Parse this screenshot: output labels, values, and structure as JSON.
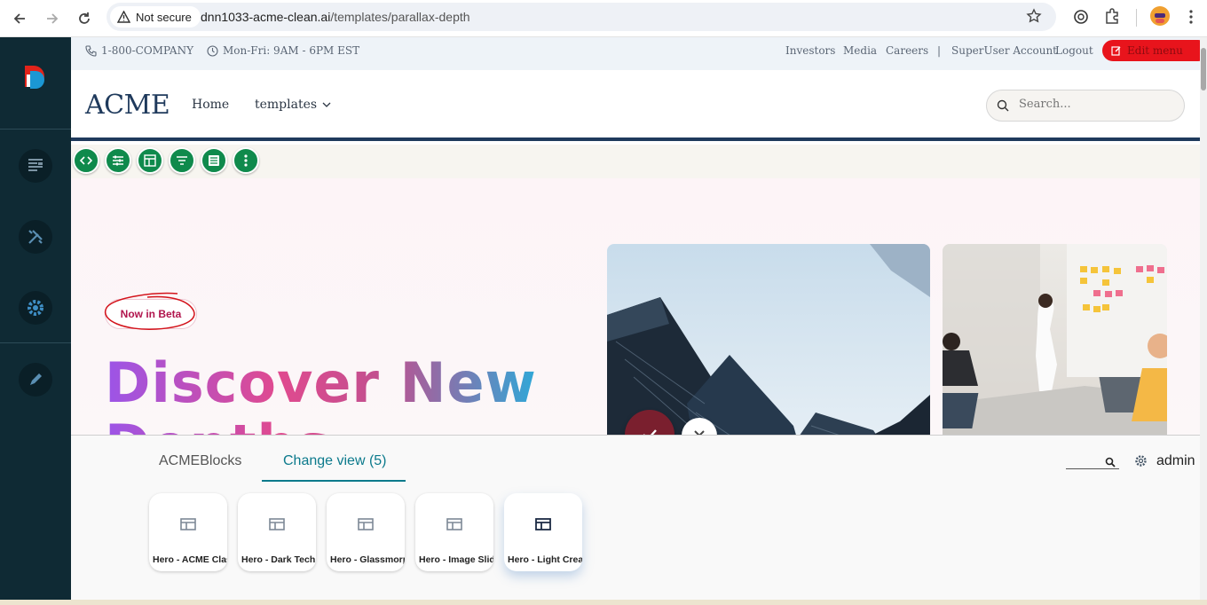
{
  "browser": {
    "security_label": "Not secure",
    "url_host": "dnn1033-acme-clean.ai",
    "url_path": "/templates/parallax-depth"
  },
  "topbar": {
    "phone": "1-800-COMPANY",
    "hours": "Mon-Fri: 9AM - 6PM EST",
    "links": [
      "Investors",
      "Media",
      "Careers"
    ],
    "separator": "|",
    "account": "SuperUser Account",
    "logout": "Logout",
    "edit_menu": "Edit menu"
  },
  "header": {
    "logo": "ACME",
    "nav": {
      "home": "Home",
      "templates": "templates"
    },
    "search_placeholder": "Search..."
  },
  "hero": {
    "badge": "Now in Beta",
    "title_line1": "Discover New",
    "title_line2": "Depths"
  },
  "panel": {
    "tab_blocks": "ACMEBlocks",
    "tab_change_view": "Change view (5)",
    "user": "admin",
    "views": [
      {
        "label": "Hero - ACME Classic"
      },
      {
        "label": "Hero - Dark Tech"
      },
      {
        "label": "Hero - Glassmorphism"
      },
      {
        "label": "Hero - Image Slider"
      },
      {
        "label": "Hero - Light Cream"
      }
    ]
  },
  "colors": {
    "dnn_sidebar": "#0f2a34",
    "accent_teal": "#0c7a8c",
    "module_green": "#0f8a4c",
    "edit_red": "#e8141c",
    "fab_maroon": "#7a1f2e",
    "brand_navy": "#1f3a5c"
  }
}
